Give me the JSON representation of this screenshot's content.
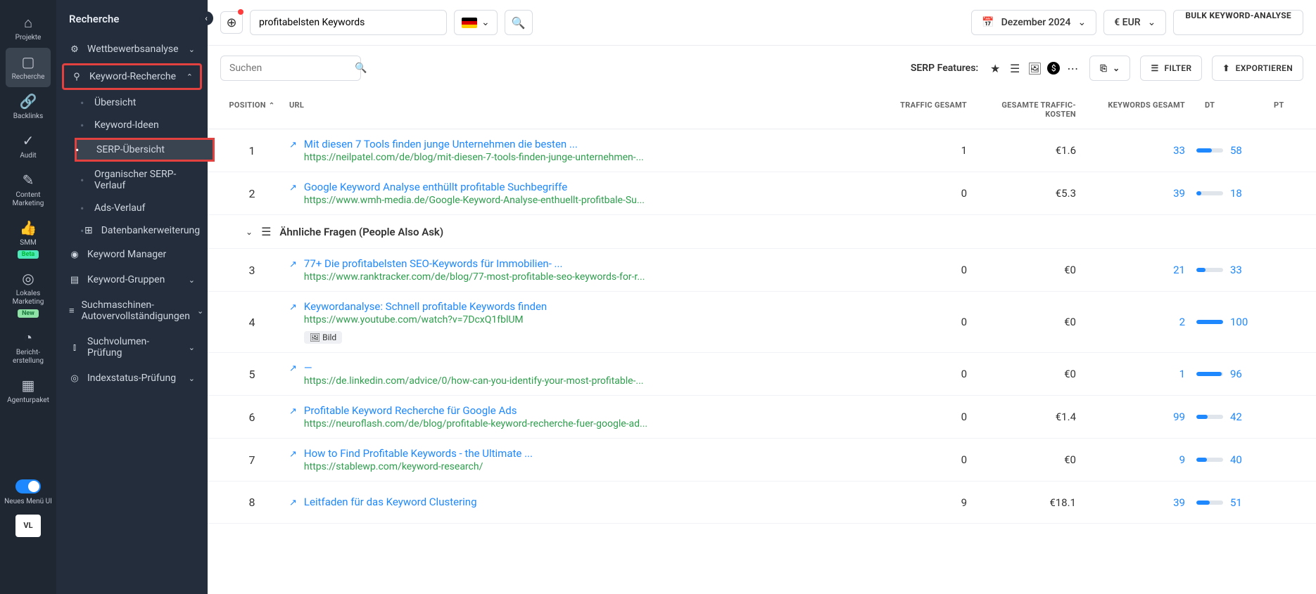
{
  "rail": {
    "items": [
      {
        "label": "Projekte",
        "icon": "⌂"
      },
      {
        "label": "Recherche",
        "icon": "▢",
        "active": true
      },
      {
        "label": "Backlinks",
        "icon": "🔗"
      },
      {
        "label": "Audit",
        "icon": "✓"
      },
      {
        "label": "Content Marketing",
        "icon": "✎"
      },
      {
        "label": "SMM",
        "icon": "👍",
        "badge": "Beta"
      },
      {
        "label": "Lokales Marketing",
        "icon": "◎",
        "badge": "New"
      },
      {
        "label": "Bericht- erstellung",
        "icon": "◔"
      },
      {
        "label": "Agenturpaket",
        "icon": "▦"
      }
    ],
    "menuToggleLabel": "Neues Menü UI",
    "avatar": "VL"
  },
  "sidebar": {
    "title": "Recherche",
    "sections": [
      {
        "icon": "⚙",
        "text": "Wettbewerbsanalyse",
        "chevron": "⌄"
      },
      {
        "icon": "⚲",
        "text": "Keyword-Recherche",
        "chevron": "⌃",
        "highlighted": true
      }
    ],
    "keywordSubItems": [
      {
        "text": "Übersicht"
      },
      {
        "text": "Keyword-Ideen"
      },
      {
        "text": "SERP-Übersicht",
        "active": true,
        "highlighted": true
      },
      {
        "text": "Organischer SERP-Verlauf"
      },
      {
        "text": "Ads-Verlauf"
      },
      {
        "text": "Datenbankerweiterung",
        "iconPrefix": "⊞"
      }
    ],
    "moreSections": [
      {
        "icon": "◉",
        "text": "Keyword Manager"
      },
      {
        "icon": "▤",
        "text": "Keyword-Gruppen",
        "chevron": "⌄"
      },
      {
        "icon": "≡",
        "text": "Suchmaschinen-Autovervollständigungen",
        "chevron": "⌄"
      },
      {
        "icon": "⫾",
        "text": "Suchvolumen-Prüfung",
        "chevron": "⌄"
      },
      {
        "icon": "◎",
        "text": "Indexstatus-Prüfung",
        "chevron": "⌄"
      }
    ]
  },
  "topbar": {
    "keywordValue": "profitabelsten Keywords",
    "dateSelector": "Dezember 2024",
    "currency": "€ EUR",
    "bulkButton": "BULK KEYWORD-ANALYSE"
  },
  "toolbar": {
    "searchPlaceholder": "Suchen",
    "serpFeaturesLabel": "SERP Features:",
    "filterLabel": "FILTER",
    "exportLabel": "EXPORTIEREN"
  },
  "table": {
    "headers": {
      "position": "POSITION",
      "url": "URL",
      "traffic": "TRAFFIC GESAMT",
      "cost": "GESAMTE TRAFFIC-KOSTEN",
      "keywords": "KEYWORDS GESAMT",
      "dt": "DT",
      "pt": "PT"
    },
    "paaLabel": "Ähnliche Fragen (People Also Ask)",
    "imageTag": "Bild",
    "rows": [
      {
        "pos": 1,
        "title": "Mit diesen 7 Tools finden junge Unternehmen die besten ...",
        "url": "https://neilpatel.com/de/blog/mit-diesen-7-tools-finden-junge-unternehmen-...",
        "traffic": "1",
        "cost": "€1.6",
        "kw": "33",
        "dt": 58
      },
      {
        "pos": 2,
        "title": "Google Keyword Analyse enthüllt profitable Suchbegriffe",
        "url": "https://www.wmh-media.de/Google-Keyword-Analyse-enthuellt-profitbale-Su...",
        "traffic": "0",
        "cost": "€5.3",
        "kw": "39",
        "dt": 18
      },
      {
        "paa": true
      },
      {
        "pos": 3,
        "title": "77+ Die profitabelsten SEO-Keywords für Immobilien- ...",
        "url": "https://www.ranktracker.com/de/blog/77-most-profitable-seo-keywords-for-r...",
        "traffic": "0",
        "cost": "€0",
        "kw": "21",
        "dt": 33
      },
      {
        "pos": 4,
        "title": "Keywordanalyse: Schnell profitable Keywords finden",
        "url": "https://www.youtube.com/watch?v=7DcxQ1fblUM",
        "traffic": "0",
        "cost": "€0",
        "kw": "2",
        "dt": 100,
        "tag": "image"
      },
      {
        "pos": 5,
        "title": "—",
        "url": "https://de.linkedin.com/advice/0/how-can-you-identify-your-most-profitable-...",
        "traffic": "0",
        "cost": "€0",
        "kw": "1",
        "dt": 96
      },
      {
        "pos": 6,
        "title": "Profitable Keyword Recherche für Google Ads",
        "url": "https://neuroflash.com/de/blog/profitable-keyword-recherche-fuer-google-ad...",
        "traffic": "0",
        "cost": "€1.4",
        "kw": "99",
        "dt": 42
      },
      {
        "pos": 7,
        "title": "How to Find Profitable Keywords - the Ultimate ...",
        "url": "https://stablewp.com/keyword-research/",
        "traffic": "0",
        "cost": "€0",
        "kw": "9",
        "dt": 40
      },
      {
        "pos": 8,
        "title": "Leitfaden für das Keyword Clustering",
        "url": "",
        "traffic": "9",
        "cost": "€18.1",
        "kw": "39",
        "dt": 51
      }
    ]
  }
}
